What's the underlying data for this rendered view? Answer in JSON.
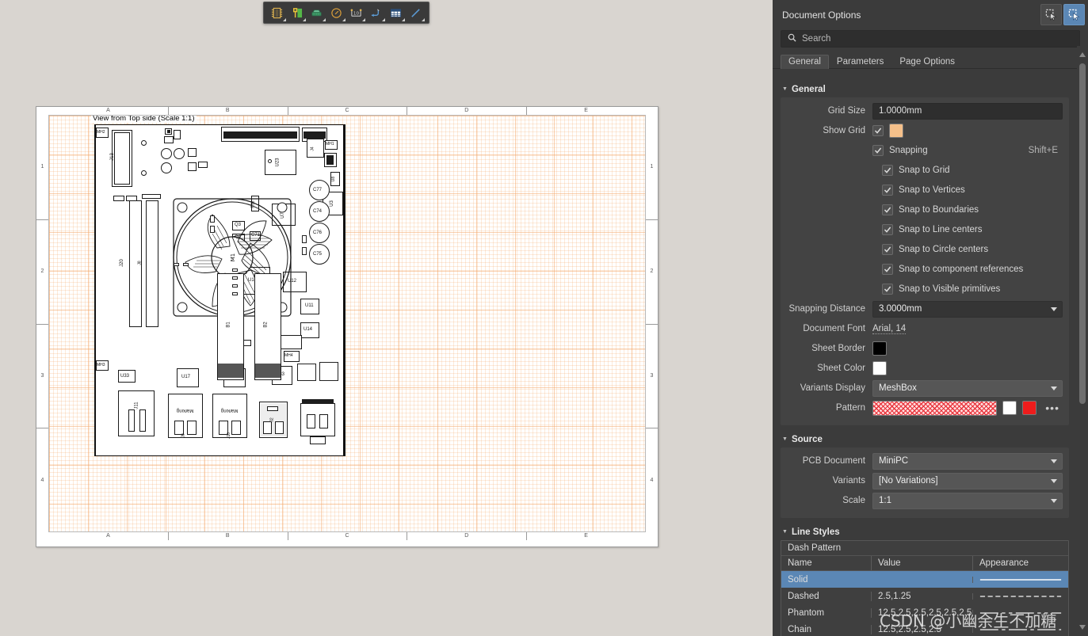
{
  "toolbar": {
    "buttons": [
      {
        "name": "place-component-icon",
        "title": "Place Component"
      },
      {
        "name": "place-polygon-icon",
        "title": "Place Polygon"
      },
      {
        "name": "place-rectangle-icon",
        "title": "Place Rectangle"
      },
      {
        "name": "place-arc-icon",
        "title": "Place Arc"
      },
      {
        "name": "place-dimension-icon",
        "title": "Place Dimension"
      },
      {
        "name": "place-leader-icon",
        "title": "Place Leader"
      },
      {
        "name": "place-bom-icon",
        "title": "Place BOM Table"
      },
      {
        "name": "place-line-icon",
        "title": "Place Line"
      }
    ]
  },
  "canvas": {
    "view_label": "View from Top side (Scale 1:1)",
    "zone_columns": [
      "A",
      "B",
      "C",
      "D",
      "E"
    ],
    "zone_rows": [
      "1",
      "2",
      "3",
      "4"
    ],
    "designators": [
      "MH2",
      "J13",
      "J20",
      "J8",
      "M1",
      "U23",
      "J4",
      "MH1",
      "U8",
      "U3",
      "C77",
      "C74",
      "C76",
      "C75",
      "U7",
      "Q3",
      "Q4",
      "C71",
      "R96",
      "U10",
      "U12",
      "U15",
      "U14",
      "U11",
      "U17",
      "U20",
      "U33",
      "J11",
      "J9",
      "J10",
      "J2",
      "J3",
      "B1",
      "B2",
      "MH3",
      "MH4",
      "J5",
      "J6",
      "J7",
      "U5",
      "U6"
    ]
  },
  "panel": {
    "title": "Document Options",
    "header_buttons": [
      {
        "name": "select-mode-icon",
        "active": false
      },
      {
        "name": "pan-mode-icon",
        "active": true
      }
    ],
    "search": {
      "placeholder": "Search",
      "value": ""
    },
    "tabs": [
      {
        "label": "General",
        "active": true
      },
      {
        "label": "Parameters",
        "active": false
      },
      {
        "label": "Page Options",
        "active": false
      }
    ],
    "sections": {
      "general": {
        "title": "General",
        "grid_size": {
          "label": "Grid Size",
          "value": "1.0000mm"
        },
        "show_grid": {
          "label": "Show Grid",
          "checked": true,
          "color": "#f5c08a"
        },
        "snapping": {
          "label": "Snapping",
          "checked": true,
          "shortcut": "Shift+E"
        },
        "snap_options": [
          {
            "label": "Snap to Grid",
            "checked": true
          },
          {
            "label": "Snap to Vertices",
            "checked": true
          },
          {
            "label": "Snap to Boundaries",
            "checked": true
          },
          {
            "label": "Snap to Line centers",
            "checked": true
          },
          {
            "label": "Snap to Circle centers",
            "checked": true
          },
          {
            "label": "Snap to component references",
            "checked": true
          },
          {
            "label": "Snap to Visible primitives",
            "checked": true
          }
        ],
        "snapping_distance": {
          "label": "Snapping Distance",
          "value": "3.0000mm"
        },
        "document_font": {
          "label": "Document Font",
          "value": "Arial, 14"
        },
        "sheet_border": {
          "label": "Sheet Border",
          "color": "#000000"
        },
        "sheet_color": {
          "label": "Sheet Color",
          "color": "#ffffff"
        },
        "variants_display": {
          "label": "Variants Display",
          "value": "MeshBox"
        },
        "pattern": {
          "label": "Pattern",
          "color1": "#ffffff",
          "color2": "#ee1c1c",
          "more": "•••"
        }
      },
      "source": {
        "title": "Source",
        "pcb_document": {
          "label": "PCB Document",
          "value": "MiniPC"
        },
        "variants": {
          "label": "Variants",
          "value": "[No Variations]"
        },
        "scale": {
          "label": "Scale",
          "value": "1:1"
        }
      },
      "line_styles": {
        "title": "Line Styles",
        "group_title": "Dash Pattern",
        "columns": [
          "Name",
          "Value",
          "Appearance"
        ],
        "rows": [
          {
            "name": "Solid",
            "value": "",
            "appearance": "solid",
            "selected": true
          },
          {
            "name": "Dashed",
            "value": "2.5,1.25",
            "appearance": "dashed",
            "selected": false
          },
          {
            "name": "Phantom",
            "value": "12.5,2.5,2.5,2.5,2.5,2.5",
            "appearance": "phantom",
            "selected": false
          },
          {
            "name": "Chain",
            "value": "12.5,2.5,2.5,2.5",
            "appearance": "chain",
            "selected": false
          }
        ]
      }
    }
  },
  "watermark": "CSDN @小幽余生不加糖",
  "colors": {
    "panel_bg": "#3b3b3b",
    "panel_section_bg": "#434343",
    "accent": "#5b87b5",
    "canvas_bg": "#d9d5d0",
    "grid": "#f4aa6e"
  }
}
